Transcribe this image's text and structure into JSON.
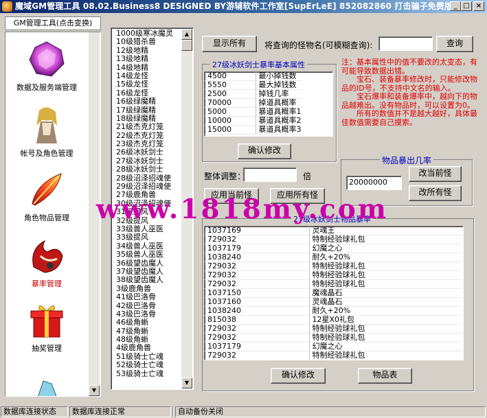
{
  "window": {
    "title": "魔域GM管理工具 08.02.Business8 DESIGNED BY游辅软件工作室[SupErLeE] 852082860 打击骗子免费版!",
    "controls": [
      "_",
      "□",
      "×"
    ]
  },
  "nav": {
    "header": "GM管理工具(点击变换)",
    "items": [
      {
        "label": "数据及服务端管理",
        "icon": "gem-icon"
      },
      {
        "label": "帐号及角色管理",
        "icon": "character-icon"
      },
      {
        "label": "角色物品管理",
        "icon": "feather-icon"
      },
      {
        "label": "暴率管理",
        "icon": "monster-icon"
      },
      {
        "label": "抽奖管理",
        "icon": "gift-icon"
      }
    ]
  },
  "monster_list": [
    "1000级寒冰魔灵",
    "10级猎杀兽",
    "12级地精",
    "13级地精",
    "14级地精",
    "14级龙怪",
    "15级龙怪",
    "16级龙怪",
    "16级绿魔精",
    "17级绿魔精",
    "18级绿魔精",
    "21级杰克灯笼",
    "22级杰克灯笼",
    "23级杰克灯笼",
    "26级冰妖剑士",
    "27级冰妖剑士",
    "28级冰妖剑士",
    "28级沼泽招魂使",
    "29级沼泽招魂使",
    "27级鹿角兽",
    "30级沼泽招魂使",
    "31级提风",
    "32级提风",
    "33级兽人巫医",
    "33级提风",
    "34级兽人巫医",
    "35级兽人巫医",
    "36级望齿魔人",
    "37级望齿魔人",
    "38级望齿魔人",
    "3级鹿角兽",
    "41级巴洛骨",
    "42级巴洛骨",
    "43级巴洛骨",
    "46级角蜥",
    "47级角蜥",
    "48级角蜥",
    "4级鹿角兽",
    "51级骑士亡魂",
    "52级骑士亡魂",
    "53级骑士亡魂"
  ],
  "toolbar": {
    "show_all": "显示所有",
    "search_label": "将查询的怪物名(可模糊查询):",
    "search_value": "",
    "search_button": "查询"
  },
  "rate_group": {
    "title": "27级冰妖剑士暴率基本属性",
    "rows": [
      [
        "4500",
        "最小掉钱数"
      ],
      [
        "5550",
        "最大掉钱数"
      ],
      [
        "2500",
        "掉钱几率"
      ],
      [
        "70000",
        "掉道具概率"
      ],
      [
        "5000",
        "暴道具概率1"
      ],
      [
        "10000",
        "暴道具概率2"
      ],
      [
        "15000",
        "暴道具概率3"
      ]
    ],
    "confirm": "确认修改"
  },
  "notes": [
    "注：基本属性中的值不要改的太变态，有可能导致数据出错。",
    "宝石、装备暴率修改时，只能修改物品的ID号，不支持中文名的输入。",
    "宝石爆率和装备爆率中，越向下的物品越难出。没有物品时，可以设置为0。",
    "所有的数值并不是越大越好，具体最佳数值需要自己摸索。"
  ],
  "adjust": {
    "label": "整体调整：",
    "value": "",
    "unit": "倍",
    "apply_current": "应用当前怪",
    "apply_all": "应用所有怪"
  },
  "drop_group": {
    "title": "物品暴出几率",
    "value": "20000000",
    "change_current": "改当前怪",
    "change_all": "改所有怪"
  },
  "items_group": {
    "title": "27级冰妖剑士物品暴率",
    "rows": [
      [
        "1037169",
        "灵魂王"
      ],
      [
        "729032",
        "特制经验球礼包"
      ],
      [
        "1037179",
        "幻魔之心"
      ],
      [
        "1038240",
        "耐久+20%"
      ],
      [
        "729032",
        "特制经验球礼包"
      ],
      [
        "729032",
        "特制经验球礼包"
      ],
      [
        "729032",
        "特制经验球礼包"
      ],
      [
        "1037150",
        "魔魂晶石"
      ],
      [
        "1037160",
        "灵魂晶石"
      ],
      [
        "1038240",
        "耐久+20%"
      ],
      [
        "815038",
        "12星X0礼包"
      ],
      [
        "729032",
        "特制经验球礼包"
      ],
      [
        "729032",
        "特制经验球礼包"
      ],
      [
        "1037179",
        "幻魔之心"
      ],
      [
        "729032",
        "特制经验球礼包"
      ]
    ],
    "confirm": "确认修改",
    "item_table": "物品表"
  },
  "watermark": "www.1818my.com",
  "status": {
    "cells": [
      "数据库连接状态",
      "数据库连接正常",
      "",
      "自动备份关闭"
    ]
  }
}
